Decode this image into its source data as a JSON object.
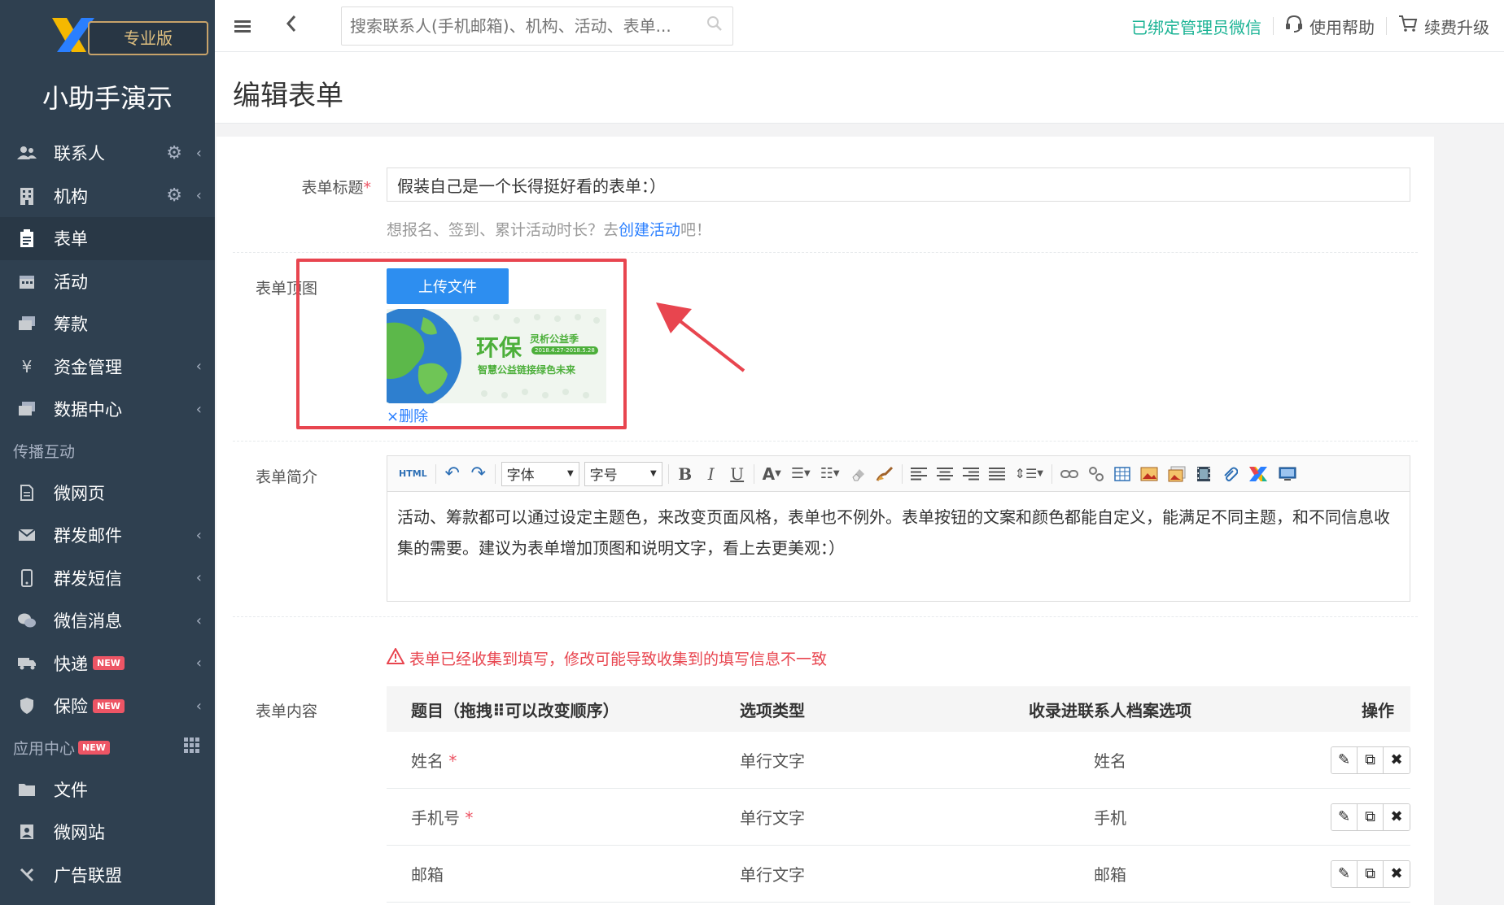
{
  "sidebar": {
    "badge": "专业版",
    "org_name": "小助手演示",
    "items": [
      {
        "label": "联系人",
        "icon": "users-icon"
      },
      {
        "label": "机构",
        "icon": "building-icon"
      },
      {
        "label": "表单",
        "icon": "clipboard-icon"
      },
      {
        "label": "活动",
        "icon": "calendar-icon"
      },
      {
        "label": "筹款",
        "icon": "money-icon"
      },
      {
        "label": "资金管理",
        "icon": "yen-icon"
      },
      {
        "label": "数据中心",
        "icon": "data-icon"
      }
    ],
    "section_broadcast": "传播互动",
    "broadcast_items": [
      {
        "label": "微网页",
        "icon": "page-icon"
      },
      {
        "label": "群发邮件",
        "icon": "mail-icon"
      },
      {
        "label": "群发短信",
        "icon": "mobile-icon"
      },
      {
        "label": "微信消息",
        "icon": "wechat-icon"
      },
      {
        "label": "快递",
        "icon": "truck-icon",
        "badge": "NEW"
      },
      {
        "label": "保险",
        "icon": "shield-icon",
        "badge": "NEW"
      }
    ],
    "section_apps": "应用中心",
    "section_apps_badge": "NEW",
    "app_items": [
      {
        "label": "文件",
        "icon": "folder-icon"
      },
      {
        "label": "微网站",
        "icon": "site-icon"
      },
      {
        "label": "广告联盟",
        "icon": "ad-icon"
      }
    ]
  },
  "topbar": {
    "search_placeholder": "搜索联系人(手机邮箱)、机构、活动、表单...",
    "wechat_bound": "已绑定管理员微信",
    "help": "使用帮助",
    "upgrade": "续费升级"
  },
  "page": {
    "title": "编辑表单"
  },
  "form": {
    "title_label": "表单标题",
    "title_value": "假装自己是一个长得挺好看的表单：）",
    "hint_prefix": "想报名、签到、累计活动时长？去",
    "hint_link": "创建活动",
    "hint_suffix": "吧！",
    "cover_label": "表单顶图",
    "upload_label": "上传文件",
    "delete_label": "×删除",
    "banner_title": "环保",
    "banner_sub": "灵析公益季",
    "banner_date": "2018.4.27-2018.5.28",
    "banner_slogan": "智慧公益链接绿色未来",
    "intro_label": "表单简介",
    "editor_font": "字体",
    "editor_size": "字号",
    "intro_text": "活动、筹款都可以通过设定主题色，来改变页面风格，表单也不例外。表单按钮的文案和颜色都能自定义，能满足不同主题，和不同信息收集的需要。建议为表单增加顶图和说明文字，看上去更美观：）",
    "warning": "表单已经收集到填写，修改可能导致收集到的填写信息不一致",
    "content_label": "表单内容",
    "table_headers": {
      "question": "题目（拖拽⠿可以改变顺序）",
      "type": "选项类型",
      "profile": "收录进联系人档案选项",
      "ops": "操作"
    },
    "rows": [
      {
        "name": "姓名",
        "required": "*",
        "type": "单行文字",
        "profile": "姓名"
      },
      {
        "name": "手机号",
        "required": "*",
        "type": "单行文字",
        "profile": "手机"
      },
      {
        "name": "邮箱",
        "required": "",
        "type": "单行文字",
        "profile": "邮箱"
      }
    ]
  },
  "colors": {
    "sidebar_bg": "#2f4050",
    "accent_blue": "#2d8ef0",
    "highlight_red": "#e8454f",
    "wechat_green": "#1ab394"
  }
}
